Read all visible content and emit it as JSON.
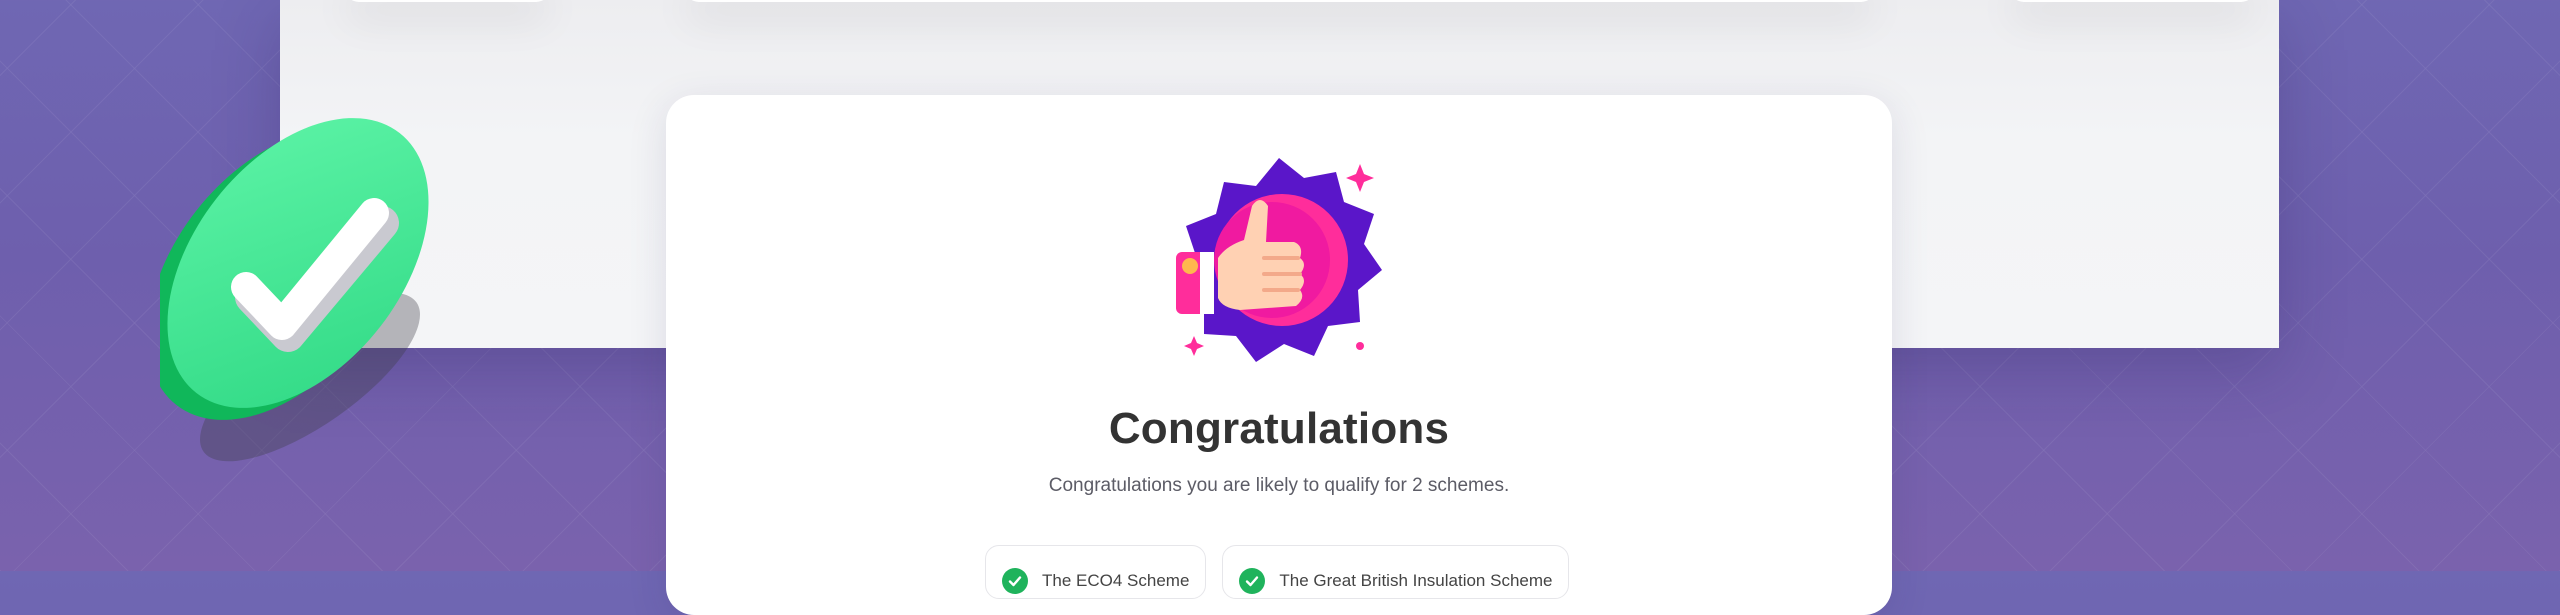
{
  "congrats": {
    "title": "Congratulations",
    "subtitle": "Congratulations you are likely to qualify for 2 schemes."
  },
  "schemes": [
    {
      "label": "The ECO4 Scheme"
    },
    {
      "label": "The Great British Insulation Scheme"
    }
  ],
  "colors": {
    "background": "#6f67b3",
    "accent_green": "#1fb35c",
    "badge_purple": "#5a16c9",
    "badge_pink": "#ff2d9b"
  },
  "icons": {
    "badge": "thumbs-up-badge-icon",
    "check": "green-check-icon",
    "chip_check": "check-circle-icon"
  }
}
